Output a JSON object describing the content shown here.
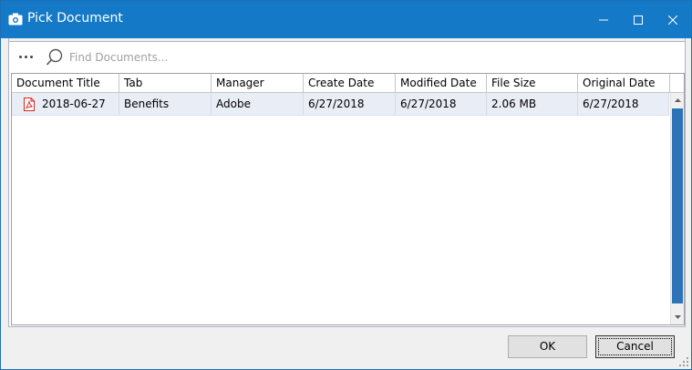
{
  "window": {
    "title": "Pick Document",
    "minimize_label": "Minimize",
    "maximize_label": "Maximize",
    "close_label": "Close"
  },
  "search": {
    "placeholder": "Find Documents...",
    "value": ""
  },
  "table": {
    "columns": [
      "Document Title",
      "Tab",
      "Manager",
      "Create Date",
      "Modified Date",
      "File Size",
      "Original Date"
    ],
    "rows": [
      {
        "icon": "pdf-file-icon",
        "document_title": "2018-06-27",
        "tab": "Benefits",
        "manager": "Adobe",
        "create_date": "6/27/2018",
        "modified_date": "6/27/2018",
        "file_size": "2.06 MB",
        "original_date": "6/27/2018"
      }
    ]
  },
  "buttons": {
    "ok": "OK",
    "cancel": "Cancel"
  },
  "colors": {
    "titlebar": "#1479c6",
    "selected_row": "#e8edf6",
    "scroll_thumb": "#2c73b8",
    "pdf_icon": "#d9261c"
  }
}
